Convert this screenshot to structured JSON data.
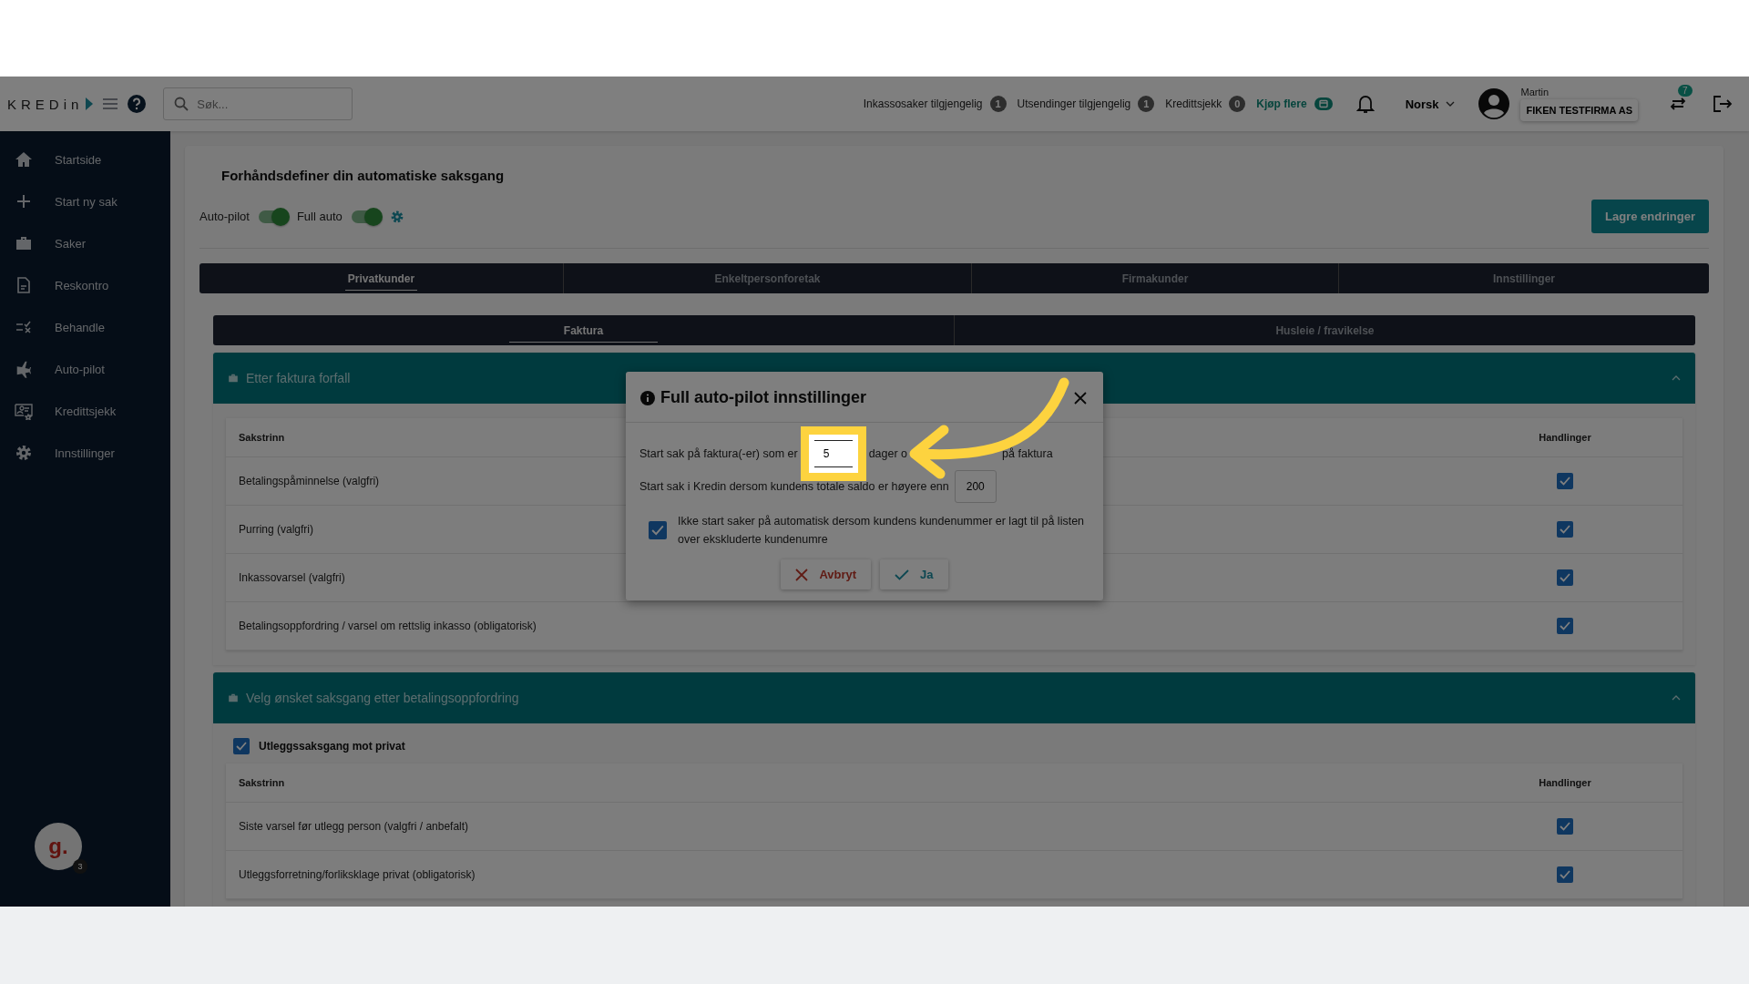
{
  "topbar": {
    "logo": "KREDin",
    "search": {
      "placeholder": "Søk..."
    },
    "counters": [
      {
        "label": "Inkassosaker tilgjengelig",
        "count": "1"
      },
      {
        "label": "Utsendinger tilgjengelig",
        "count": "1"
      },
      {
        "label": "Kredittsjekk",
        "count": "0"
      }
    ],
    "buy_link": "Kjøp flere",
    "language": "Norsk",
    "user_name": "Martin",
    "company": "FIKEN TESTFIRMA AS",
    "switch_badge": "7"
  },
  "sidebar": {
    "items": [
      {
        "label": "Startside"
      },
      {
        "label": "Start ny sak"
      },
      {
        "label": "Saker"
      },
      {
        "label": "Reskontro"
      },
      {
        "label": "Behandle"
      },
      {
        "label": "Auto-pilot"
      },
      {
        "label": "Kredittsjekk"
      },
      {
        "label": "Innstillinger"
      }
    ],
    "chat_widget": {
      "label": "g.",
      "badge": "3"
    }
  },
  "page": {
    "title": "Forhåndsdefiner din automatiske saksgang",
    "toggles": [
      {
        "label": "Auto-pilot",
        "on": true
      },
      {
        "label": "Full auto",
        "on": true
      }
    ],
    "save_button": "Lagre endringer",
    "tabs": [
      {
        "label": "Privatkunder",
        "selected": true
      },
      {
        "label": "Enkeltpersonforetak",
        "selected": false
      },
      {
        "label": "Firmakunder",
        "selected": false
      },
      {
        "label": "Innstillinger",
        "selected": false
      }
    ],
    "subtabs": [
      {
        "label": "Faktura",
        "selected": true
      },
      {
        "label": "Husleie / fravikelse",
        "selected": false
      }
    ],
    "sections": [
      {
        "title": "Etter faktura forfall",
        "expanded": true,
        "columns": [
          "Sakstrinn",
          "Handlinger"
        ],
        "rows": [
          {
            "label": "Betalingspåminnelse (valgfri)",
            "checked": true
          },
          {
            "label": "Purring (valgfri)",
            "checked": true
          },
          {
            "label": "Inkassovarsel (valgfri)",
            "checked": true
          },
          {
            "label": "Betalingsoppfordring / varsel om rettslig inkasso (obligatorisk)",
            "checked": true
          }
        ]
      },
      {
        "title": "Velg ønsket saksgang etter betalingsoppfordring",
        "expanded": true,
        "option": {
          "label": "Utleggssaksgang mot privat",
          "checked": true
        },
        "columns": [
          "Sakstrinn",
          "Handlinger"
        ],
        "rows": [
          {
            "label": "Siste varsel før utlegg person (valgfri / anbefalt)",
            "checked": true
          },
          {
            "label": "Utleggsforretning/forliksklage privat (obligatorisk)",
            "checked": true
          }
        ]
      }
    ]
  },
  "modal": {
    "title": "Full auto-pilot innstillinger",
    "days_row": {
      "before": "Start sak på faktura(-er) som er",
      "value": "5",
      "after_visible": "dager o",
      "after_end": "på faktura"
    },
    "amount_row": {
      "label": "Start sak i Kredin dersom kundens totale saldo er høyere enn",
      "value": "200"
    },
    "exclude": {
      "label": "Ikke start saker på automatisk dersom kundens kundenummer er lagt til på listen over ekskluderte kundenumre",
      "checked": true
    },
    "buttons": [
      {
        "label": "Avbryt",
        "kind": "cancel"
      },
      {
        "label": "Ja",
        "kind": "confirm"
      }
    ]
  }
}
